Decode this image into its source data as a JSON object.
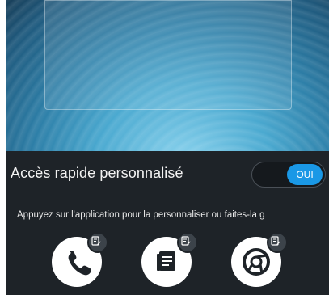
{
  "quick_access": {
    "label": "Accès rapide personnalisé",
    "toggle_state": "OUI"
  },
  "hint": "Appuyez sur l'application pour la personnaliser ou faites-la g",
  "apps": [
    {
      "icon": "phone-icon",
      "badge_icon": "edit-icon"
    },
    {
      "icon": "notes-icon",
      "badge_icon": "edit-icon"
    },
    {
      "icon": "chrome-icon",
      "badge_icon": "edit-icon"
    }
  ],
  "colors": {
    "panel": "#1e2328",
    "accent": "#1a98e6"
  }
}
